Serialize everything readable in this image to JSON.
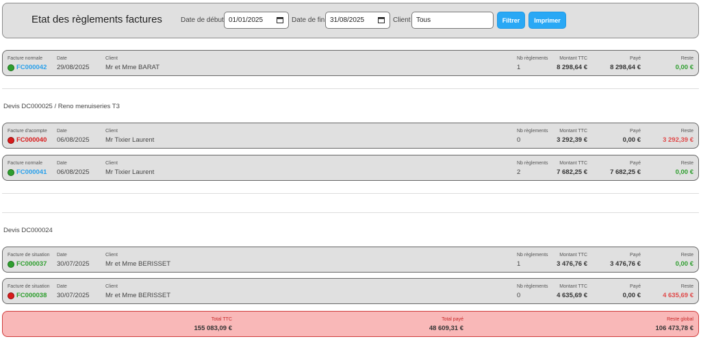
{
  "header": {
    "title": "Etat des règlements factures",
    "start_label": "Date de début",
    "start_value": "01/01/2025",
    "end_label": "Date de fin",
    "end_value": "31/08/2025",
    "client_label": "Client",
    "client_value": "Tous",
    "filter_label": "Filtrer",
    "print_label": "Imprimer"
  },
  "columns": {
    "date": "Date",
    "client": "Client",
    "nb": "Nb règlements",
    "ttc": "Montant TTC",
    "paid": "Payé",
    "rest": "Reste"
  },
  "groups": {
    "g1": "Devis DC000025 / Reno menuiseries T3",
    "g2": "Devis DC000024"
  },
  "invoices": [
    {
      "type": "Facture normale",
      "number": "FC000042",
      "status": "green",
      "date": "29/08/2025",
      "client": "Mr et Mme BARAT",
      "nb": "1",
      "ttc": "8 298,64 €",
      "paid": "8 298,64 €",
      "rest": "0,00 €"
    },
    {
      "type": "Facture d'acompte",
      "number": "FC000040",
      "status": "red",
      "date": "06/08/2025",
      "client": "Mr Tixier Laurent",
      "nb": "0",
      "ttc": "3 292,39 €",
      "paid": "0,00 €",
      "rest": "3 292,39 €"
    },
    {
      "type": "Facture normale",
      "number": "FC000041",
      "status": "green",
      "date": "06/08/2025",
      "client": "Mr Tixier Laurent",
      "nb": "2",
      "ttc": "7 682,25 €",
      "paid": "7 682,25 €",
      "rest": "0,00 €"
    },
    {
      "type": "Facture de situation",
      "number": "FC000037",
      "status": "green",
      "date": "30/07/2025",
      "client": "Mr et Mme BERISSET",
      "nb": "1",
      "ttc": "3 476,76 €",
      "paid": "3 476,76 €",
      "rest": "0,00 €"
    },
    {
      "type": "Facture de situation",
      "number": "FC000038",
      "status": "red",
      "date": "30/07/2025",
      "client": "Mr et Mme BERISSET",
      "nb": "0",
      "ttc": "4 635,69 €",
      "paid": "0,00 €",
      "rest": "4 635,69 €"
    }
  ],
  "totals": {
    "ttc_label": "Total TTC",
    "ttc_value": "155 083,09 €",
    "paid_label": "Total payé",
    "paid_value": "48 609,31 €",
    "rest_label": "Reste global",
    "rest_value": "106 473,78 €"
  },
  "colors": {
    "link_blue": "#2aa0ea",
    "paid_green": "#2e9e2e",
    "due_red": "#e04848",
    "accent_button": "#29a8f5",
    "totals_bg": "#f9b8b8"
  }
}
